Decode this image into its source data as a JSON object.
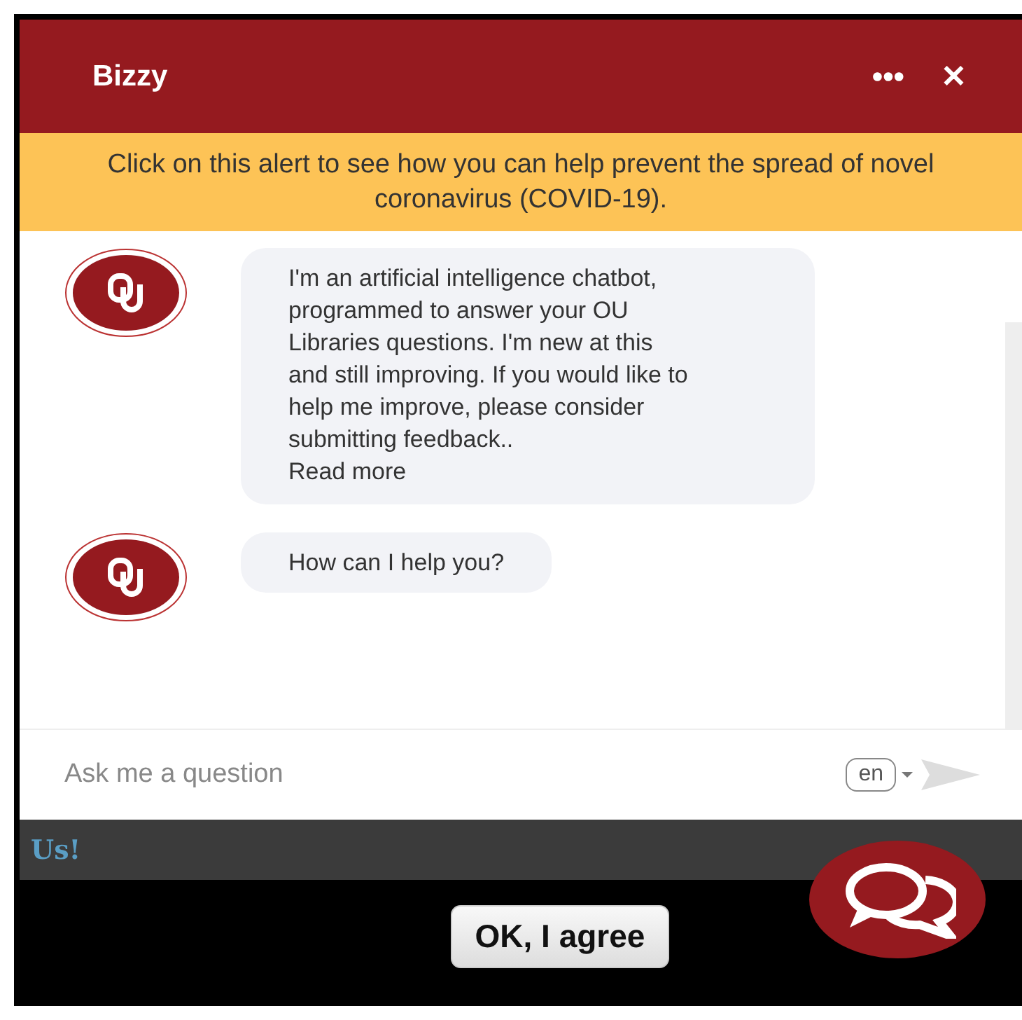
{
  "header": {
    "title": "Bizzy",
    "menu": "•••",
    "close": "✕"
  },
  "alert": "Click on this alert to see how you can help prevent the spread of novel coronavirus (COVID-19).",
  "messages": [
    {
      "text": "I'm an artificial intelligence chatbot, programmed to answer your OU Libraries questions. I'm new at this and still improving. If you would like to help me improve, please consider submitting feedback..",
      "link": "Read more"
    },
    {
      "text": "How can I help you?"
    }
  ],
  "input": {
    "placeholder": "Ask me a question",
    "language": "en"
  },
  "footer_text": "Us!",
  "agree_button": "OK, I agree"
}
